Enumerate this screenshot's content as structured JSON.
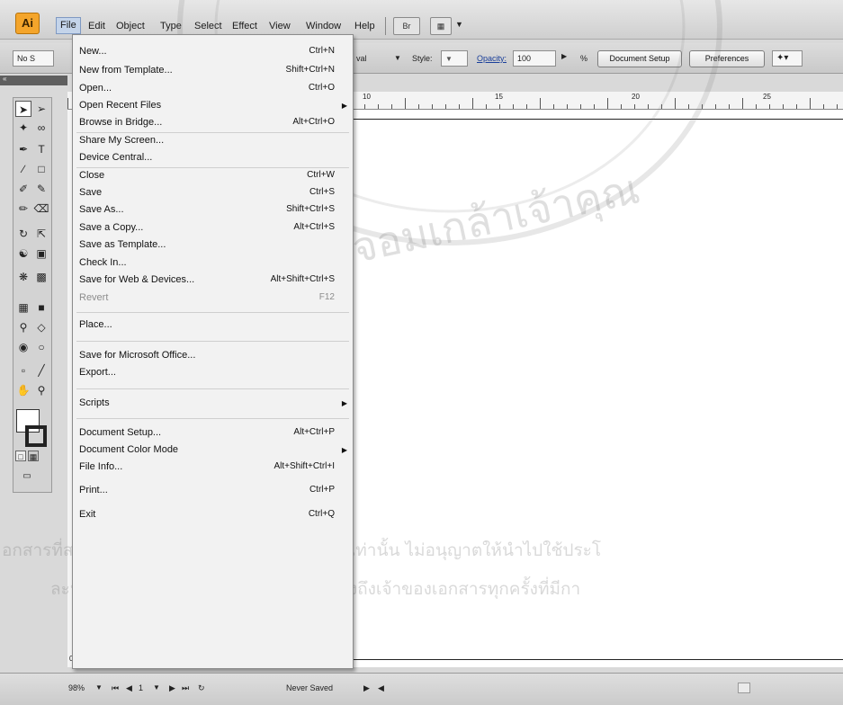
{
  "app": {
    "logo": "Ai"
  },
  "menubar": {
    "items": [
      "File",
      "Edit",
      "Object",
      "Type",
      "Select",
      "Effect",
      "View",
      "Window",
      "Help"
    ],
    "bridge_icon": "bridge-icon",
    "arrange_icon": "arrange-documents-icon"
  },
  "controlbar": {
    "no_selection": "No S",
    "val_fragment": "val",
    "style_label": "Style:",
    "opacity_label": "Opacity:",
    "opacity_value": "100",
    "percent": "%",
    "document_setup": "Document Setup",
    "preferences": "Preferences"
  },
  "ruler": {
    "labels": [
      "10",
      "15",
      "20",
      "25"
    ]
  },
  "file_menu": [
    {
      "label": "New...",
      "shortcut": "Ctrl+N"
    },
    {
      "label": "New from Template...",
      "shortcut": "Shift+Ctrl+N"
    },
    {
      "label": "Open...",
      "shortcut": "Ctrl+O"
    },
    {
      "label": "Open Recent Files",
      "shortcut": "",
      "submenu": true
    },
    {
      "label": "Browse in Bridge...",
      "shortcut": "Alt+Ctrl+O"
    },
    {
      "label": "Share My Screen...",
      "shortcut": ""
    },
    {
      "label": "Device Central...",
      "shortcut": ""
    },
    {
      "label": "Close",
      "shortcut": "Ctrl+W"
    },
    {
      "label": "Save",
      "shortcut": "Ctrl+S"
    },
    {
      "label": "Save As...",
      "shortcut": "Shift+Ctrl+S"
    },
    {
      "label": "Save a Copy...",
      "shortcut": "Alt+Ctrl+S"
    },
    {
      "label": "Save as Template...",
      "shortcut": ""
    },
    {
      "label": "Check In...",
      "shortcut": ""
    },
    {
      "label": "Save for Web & Devices...",
      "shortcut": "Alt+Shift+Ctrl+S"
    },
    {
      "label": "Revert",
      "shortcut": "F12",
      "disabled": true
    },
    {
      "label": "Place...",
      "shortcut": ""
    },
    {
      "label": "Save for Microsoft Office...",
      "shortcut": ""
    },
    {
      "label": "Export...",
      "shortcut": ""
    },
    {
      "label": "Scripts",
      "shortcut": "",
      "submenu": true
    },
    {
      "label": "Document Setup...",
      "shortcut": "Alt+Ctrl+P"
    },
    {
      "label": "Document Color Mode",
      "shortcut": "",
      "submenu": true
    },
    {
      "label": "File Info...",
      "shortcut": "Alt+Shift+Ctrl+I"
    },
    {
      "label": "Print...",
      "shortcut": "Ctrl+P"
    },
    {
      "label": "Exit",
      "shortcut": "Ctrl+Q"
    }
  ],
  "statusbar": {
    "zoom": "98%",
    "artboard_number": "1",
    "status": "Never Saved"
  },
  "vruler": {
    "label": "0"
  },
  "watermark": {
    "line1": "อกสารที่สงวนไว้สำหรับการใช้งานเพื่อการศึกษาเท่านั้น ไม่อนุญาตให้นำไปใช้ประโ",
    "line2": "ละห้ามมิให้ดัดแปลงเนื้อหา และต้องอ้างอิงถึงเจ้าของเอกสารทุกครั้งที่มีกา",
    "seal": "พระจอมเกล้าเจ้าคุณ"
  }
}
